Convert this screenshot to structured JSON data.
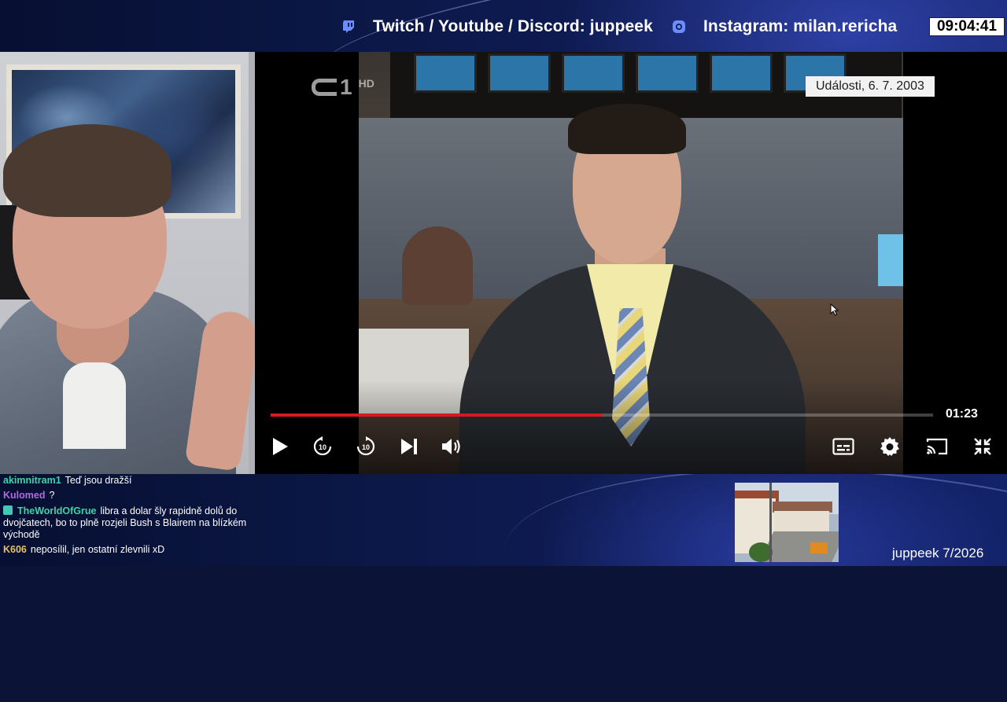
{
  "header": {
    "social_1": "Twitch / Youtube / Discord: juppeek",
    "social_1_icon": "twitch-icon",
    "social_2": "Instagram: milan.rericha",
    "social_2_icon": "instagram-icon",
    "clock": "09:04:41"
  },
  "video": {
    "channel_logo_num": "1",
    "channel_logo_hd": "HD",
    "caption": "Události, 6. 7. 2003",
    "time": "01:23",
    "progress_fraction": 0.5,
    "accent_color": "#d8191f",
    "controls_left": [
      "play-icon",
      "rewind-10-icon",
      "forward-10-icon",
      "next-icon",
      "volume-icon"
    ],
    "controls_right": [
      "subtitles-icon",
      "settings-gear-icon",
      "cast-icon",
      "exit-fullscreen-icon"
    ],
    "skip_label": "10"
  },
  "chat": {
    "messages": [
      {
        "user": "akimnitram1",
        "color": "#3fd3a6",
        "text": "Teď jsou dražší"
      },
      {
        "user": "Kulomed",
        "color": "#b06be0",
        "text": "?"
      },
      {
        "user": "TheWorldOfGrue",
        "color": "#3fd3a6",
        "text": "libra a dolar šly rapidně dolů do dvojčatech, bo to plně rozjeli Bush s Blairem na blízkém východě"
      },
      {
        "user": "K606",
        "color": "#e2c16b",
        "text": "neposílil, jen ostatní zlevnili xD"
      }
    ]
  },
  "footer": {
    "watermark": "juppeek 7/2026"
  }
}
